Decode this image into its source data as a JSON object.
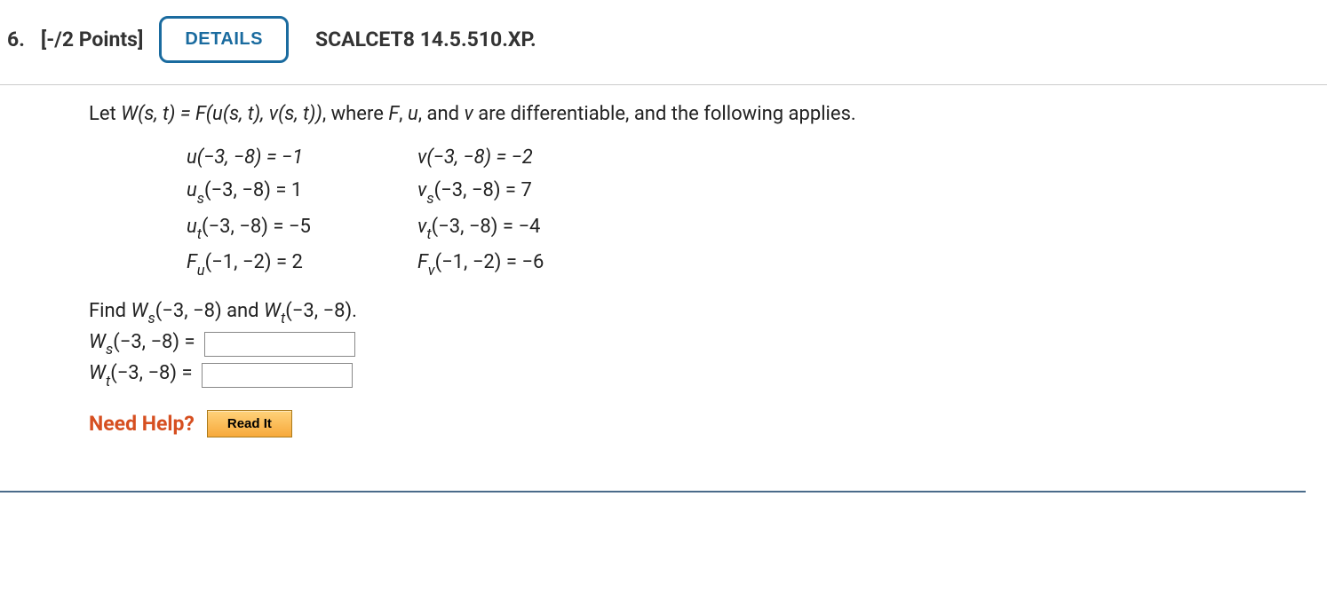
{
  "header": {
    "question_number": "6.",
    "points": "[-/2 Points]",
    "details_label": "DETAILS",
    "reference": "SCALCET8 14.5.510.XP."
  },
  "problem": {
    "prompt_prefix": "Let ",
    "prompt_eq_lhs": "W(s, t)",
    "prompt_eq_rhs": " = F(u(s, t), v(s, t))",
    "prompt_suffix": ", where F, u, and v are differentiable, and the following applies.",
    "equations": {
      "r1c1": "u(−3, −8) = −1",
      "r1c2": "v(−3, −8) = −2",
      "r2c1_fn": "u",
      "r2c1_sub": "s",
      "r2c1_rest": "(−3, −8) = 1",
      "r2c2_fn": "v",
      "r2c2_sub": "s",
      "r2c2_rest": "(−3, −8) = 7",
      "r3c1_fn": "u",
      "r3c1_sub": "t",
      "r3c1_rest": "(−3, −8) = −5",
      "r3c2_fn": "v",
      "r3c2_sub": "t",
      "r3c2_rest": "(−3, −8) = −4",
      "r4c1_fn": "F",
      "r4c1_sub": "u",
      "r4c1_rest": "(−1, −2) = 2",
      "r4c2_fn": "F",
      "r4c2_sub": "v",
      "r4c2_rest": "(−1, −2) = −6"
    },
    "find_prefix": "Find ",
    "find_ws_fn": "W",
    "find_ws_sub": "s",
    "find_ws_arg": "(−3, −8)",
    "find_and": " and ",
    "find_wt_fn": "W",
    "find_wt_sub": "t",
    "find_wt_arg": "(−3, −8).",
    "ans1_fn": "W",
    "ans1_sub": "s",
    "ans1_rest": "(−3, −8) =",
    "ans2_fn": "W",
    "ans2_sub": "t",
    "ans2_rest": "(−3, −8) =",
    "answer1_value": "",
    "answer2_value": ""
  },
  "help": {
    "need_help_label": "Need Help?",
    "read_it_label": "Read It"
  }
}
